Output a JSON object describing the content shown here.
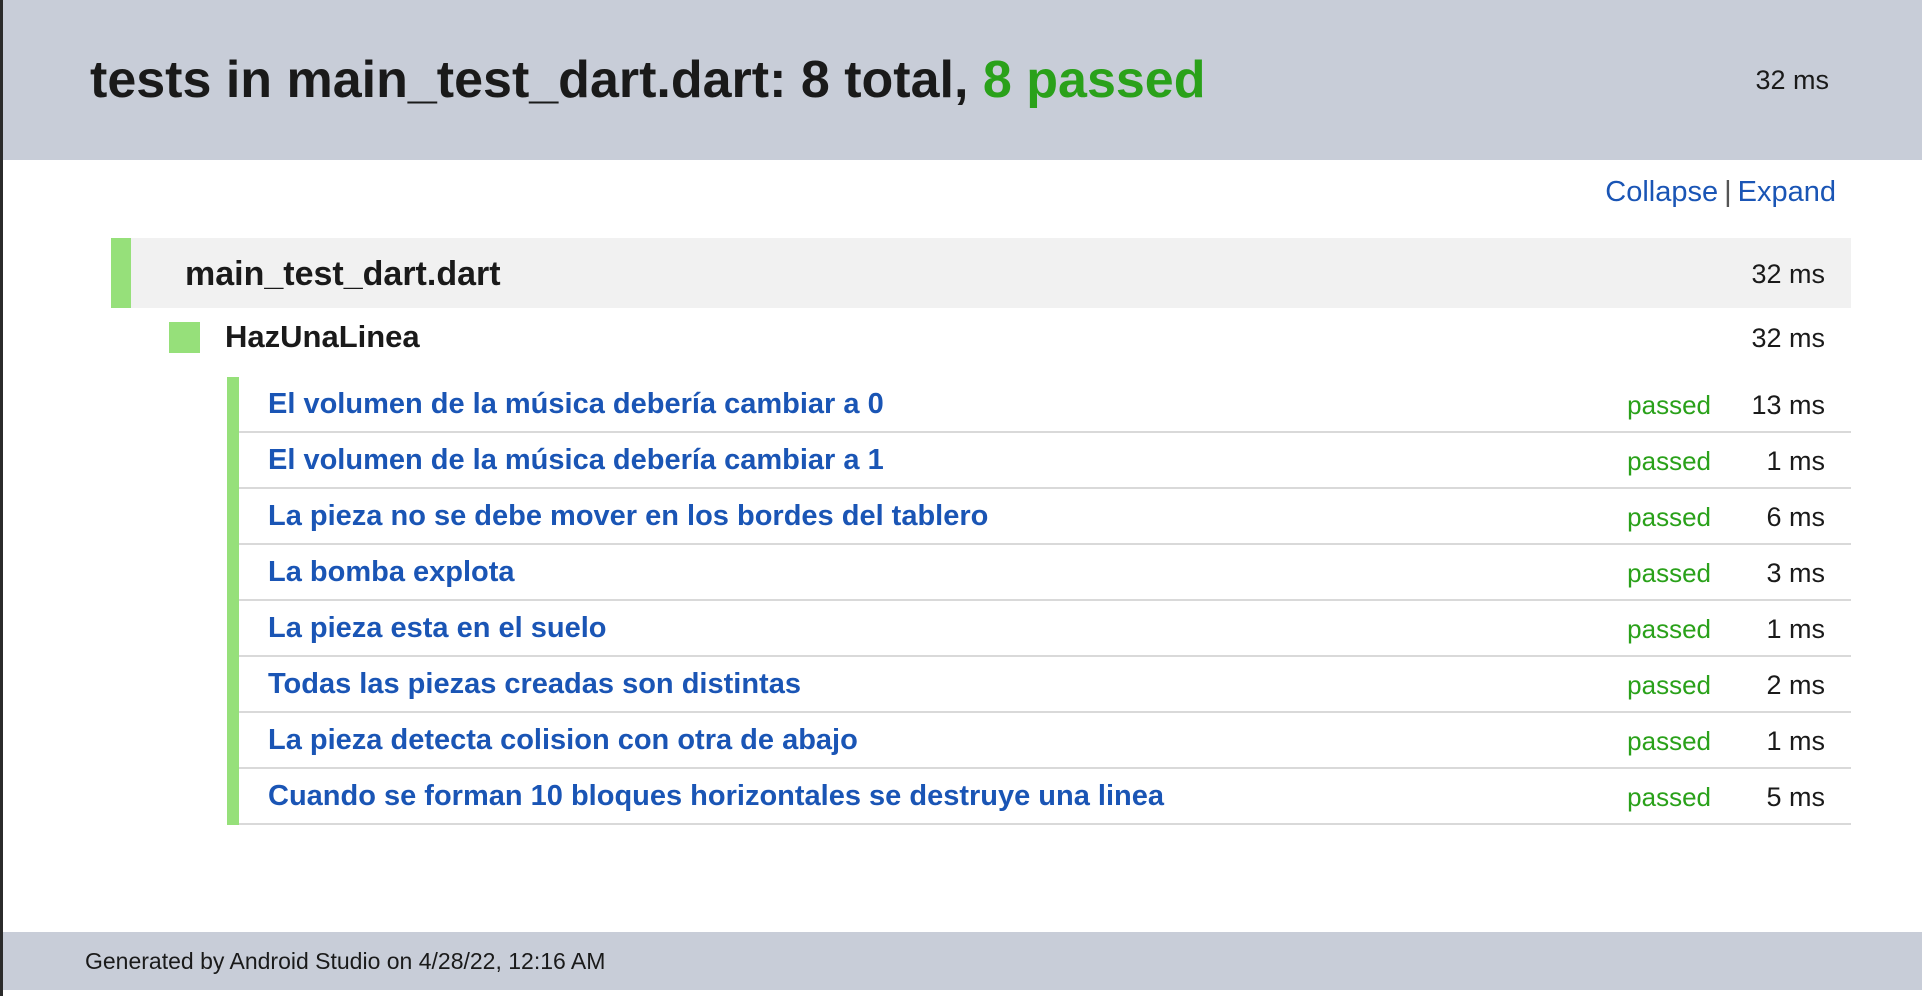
{
  "header": {
    "title_prefix": "tests in main_test_dart.dart: 8 total, ",
    "title_passed": "8 passed",
    "duration": "32 ms"
  },
  "toolbar": {
    "collapse_label": "Collapse",
    "separator": "|",
    "expand_label": "Expand"
  },
  "file": {
    "name": "main_test_dart.dart",
    "duration": "32 ms",
    "status_color": "#96e07a"
  },
  "group": {
    "name": "HazUnaLinea",
    "duration": "32 ms"
  },
  "tests": [
    {
      "name": "El volumen de la música debería cambiar a 0",
      "status": "passed",
      "duration": "13 ms"
    },
    {
      "name": "El volumen de la música debería cambiar a 1",
      "status": "passed",
      "duration": "1 ms"
    },
    {
      "name": "La pieza no se debe mover en los bordes del tablero",
      "status": "passed",
      "duration": "6 ms"
    },
    {
      "name": "La bomba explota",
      "status": "passed",
      "duration": "3 ms"
    },
    {
      "name": "La pieza esta en el suelo",
      "status": "passed",
      "duration": "1 ms"
    },
    {
      "name": "Todas las piezas creadas son distintas",
      "status": "passed",
      "duration": "2 ms"
    },
    {
      "name": "La pieza detecta colision con otra de abajo",
      "status": "passed",
      "duration": "1 ms"
    },
    {
      "name": "Cuando se forman 10 bloques horizontales se destruye una linea",
      "status": "passed",
      "duration": "5 ms"
    }
  ],
  "footer": {
    "text": "Generated by Android Studio on 4/28/22, 12:16 AM"
  },
  "colors": {
    "header_bg": "#c8cdd8",
    "passed": "#2aa11a",
    "link": "#1a55b5",
    "status_bar": "#96e07a"
  }
}
